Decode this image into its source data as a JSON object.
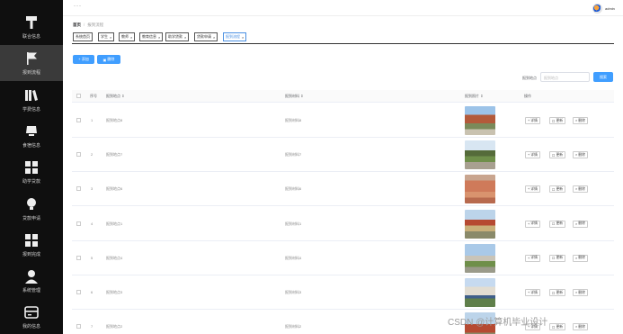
{
  "sidebar": {
    "items": [
      {
        "label": "联合信息",
        "icon": "tool-icon"
      },
      {
        "label": "报到流程",
        "icon": "flag-icon"
      },
      {
        "label": "学费信息",
        "icon": "library-icon"
      },
      {
        "label": "食宿信息",
        "icon": "monitor-icon"
      },
      {
        "label": "助学贷款",
        "icon": "grid-icon"
      },
      {
        "label": "贷款申请",
        "icon": "bulb-icon"
      },
      {
        "label": "报到完成",
        "icon": "grid-icon"
      },
      {
        "label": "系统管理",
        "icon": "user-icon"
      },
      {
        "label": "我的信息",
        "icon": "card-icon"
      }
    ]
  },
  "topbar": {
    "menu_dots": "···",
    "username": "admin"
  },
  "breadcrumb": {
    "home": "首页",
    "current": "报到流程"
  },
  "tags": [
    {
      "label": "系统首页"
    },
    {
      "label": "学生"
    },
    {
      "label": "教师"
    },
    {
      "label": "教育信息"
    },
    {
      "label": "助学贷款"
    },
    {
      "label": "贷款申请"
    },
    {
      "label": "报到流程",
      "active": true
    }
  ],
  "toolbar": {
    "add_label": "+ 添加",
    "delete_label": "删除"
  },
  "search": {
    "label": "报到地点",
    "placeholder": "报到地点",
    "button": "搜索"
  },
  "table": {
    "headers": {
      "index": "序号",
      "place": "报到地点",
      "material": "报到材料",
      "photo": "报到照片",
      "actions": "操作"
    },
    "rows": [
      {
        "index": "1",
        "place": "报到地点8",
        "material": "报到材料8"
      },
      {
        "index": "2",
        "place": "报到地点7",
        "material": "报到材料7"
      },
      {
        "index": "3",
        "place": "报到地点6",
        "material": "报到材料6"
      },
      {
        "index": "4",
        "place": "报到地点1",
        "material": "报到材料1"
      },
      {
        "index": "5",
        "place": "报到地点4",
        "material": "报到材料4"
      },
      {
        "index": "6",
        "place": "报到地点3",
        "material": "报到材料3"
      },
      {
        "index": "7",
        "place": "报到地点2",
        "material": "报到材料2"
      }
    ],
    "actions": {
      "detail": "详情",
      "edit": "更新",
      "delete": "删除"
    }
  },
  "watermark": "CSDN @计算机毕业设计"
}
